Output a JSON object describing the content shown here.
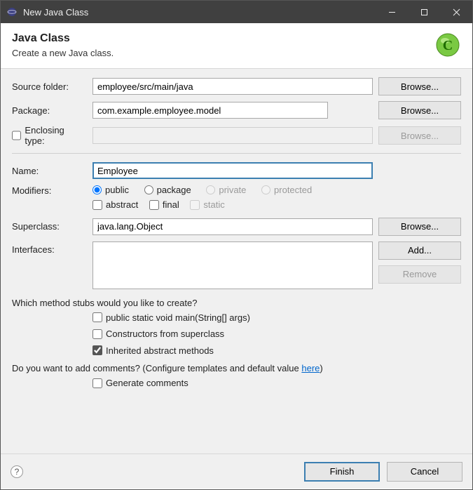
{
  "window": {
    "title": "New Java Class"
  },
  "header": {
    "title": "Java Class",
    "subtitle": "Create a new Java class."
  },
  "labels": {
    "source_folder": "Source folder:",
    "package": "Package:",
    "enclosing_type": "Enclosing type:",
    "name": "Name:",
    "modifiers": "Modifiers:",
    "superclass": "Superclass:",
    "interfaces": "Interfaces:",
    "browse": "Browse...",
    "add": "Add...",
    "remove": "Remove",
    "stubs_question": "Which method stubs would you like to create?",
    "stub_main": "public static void main(String[] args)",
    "stub_constructors": "Constructors from superclass",
    "stub_inherited": "Inherited abstract methods",
    "comments_question_prefix": "Do you want to add comments? (Configure templates and default value ",
    "comments_here": "here",
    "comments_question_suffix": ")",
    "generate_comments": "Generate comments",
    "finish": "Finish",
    "cancel": "Cancel"
  },
  "modifiers": {
    "visibility": {
      "public": "public",
      "package": "package",
      "private": "private",
      "protected": "protected"
    },
    "abstract": "abstract",
    "final": "final",
    "static": "static"
  },
  "values": {
    "source_folder": "employee/src/main/java",
    "package": "com.example.employee.model",
    "enclosing_type": "",
    "enclosing_enabled": false,
    "name": "Employee",
    "visibility_selected": "public",
    "abstract": false,
    "final": false,
    "static": false,
    "superclass": "java.lang.Object",
    "interfaces": [],
    "stub_main": false,
    "stub_constructors": false,
    "stub_inherited": true,
    "generate_comments": false
  }
}
